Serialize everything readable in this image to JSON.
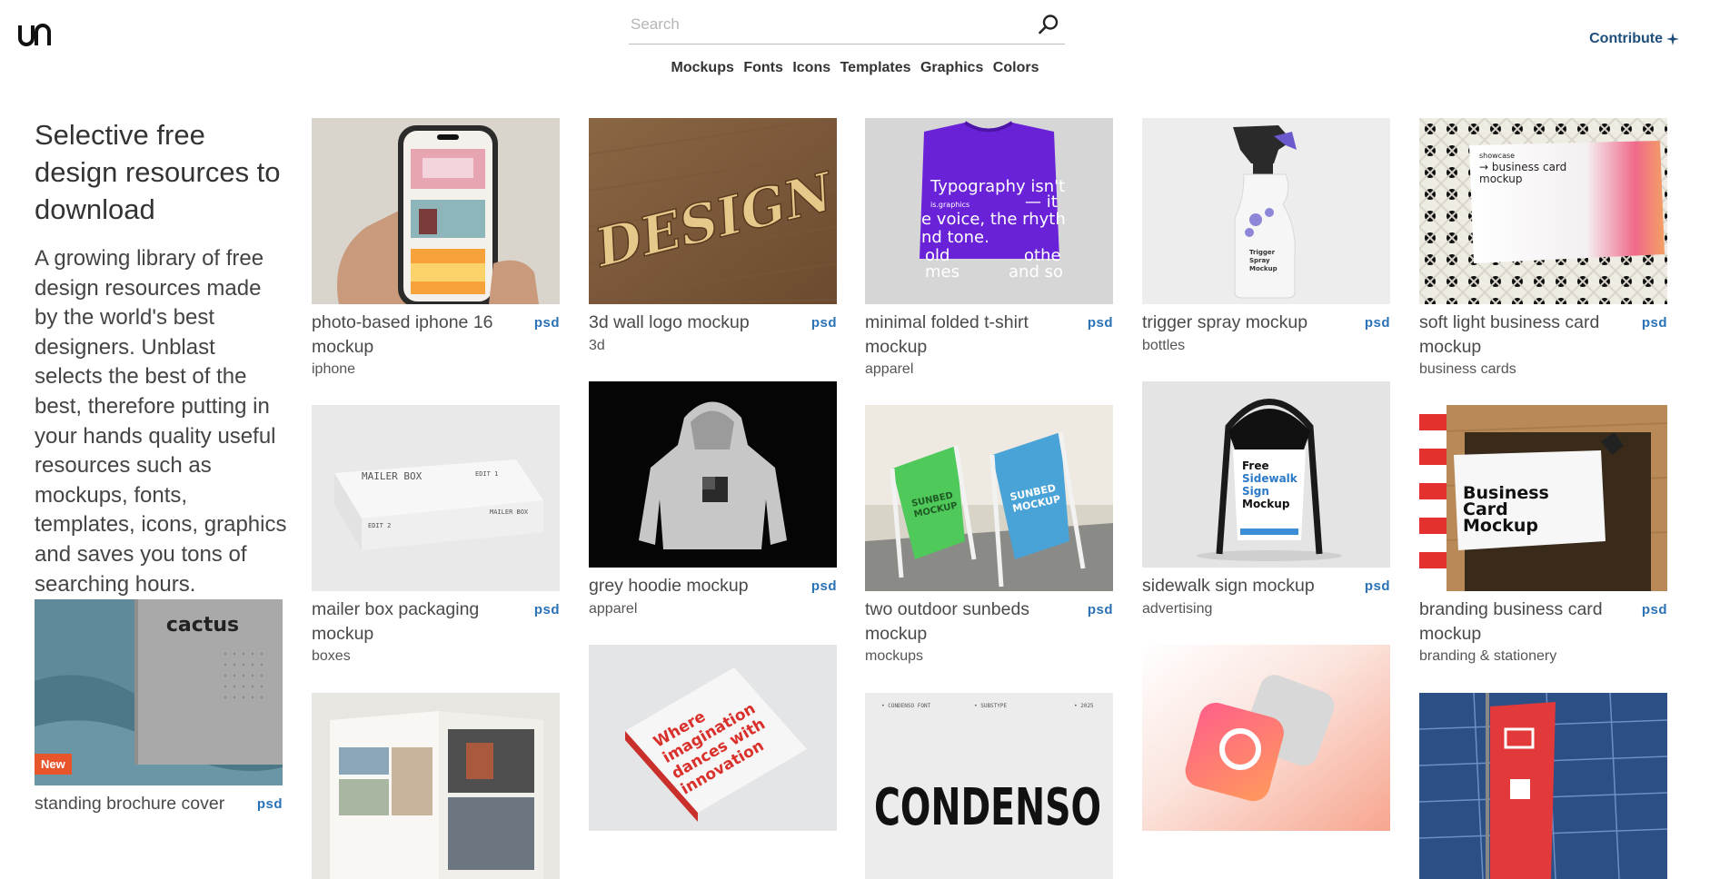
{
  "header": {
    "logo_text": "un",
    "search_placeholder": "Search",
    "contribute_label": "Contribute",
    "contribute_icon": "sparkle-icon"
  },
  "nav": [
    "Mockups",
    "Fonts",
    "Icons",
    "Templates",
    "Graphics",
    "Colors"
  ],
  "intro": {
    "heading": "Selective free design resources to download",
    "body": "A growing library of free design resources made by the world's best designers. Unblast selects the best of the best, therefore putting in your hands quality useful resources such as mockups, fonts, templates, icons, graphics and saves you tons of searching hours."
  },
  "cards": [
    {
      "title": "photo-based iphone 16 mockup",
      "format": "psd",
      "category": "iphone"
    },
    {
      "title": "3d wall logo mockup",
      "format": "psd",
      "category": "3d",
      "image_text": "DESIGN"
    },
    {
      "title": "minimal folded t-shirt mockup",
      "format": "psd",
      "category": "apparel",
      "image_text": [
        "Typography isn't",
        "is.graphics",
        "— it",
        "e voice, the rhyth",
        "nd tone.",
        "old",
        "othe",
        "mes",
        "and so"
      ]
    },
    {
      "title": "trigger spray mockup",
      "format": "psd",
      "category": "bottles",
      "image_text": [
        "Trigger",
        "Spray",
        "Mockup"
      ]
    },
    {
      "title": "soft light business card mockup",
      "format": "psd",
      "category": "business cards",
      "image_text": [
        "showcase",
        "→ business card",
        "mockup"
      ]
    },
    {
      "title": "mailer box packaging mockup",
      "format": "psd",
      "category": "boxes",
      "image_text": [
        "MAILER BOX",
        "EDIT 1",
        "EDIT 2",
        "MAILER BOX"
      ]
    },
    {
      "title": "grey hoodie mockup",
      "format": "psd",
      "category": "apparel"
    },
    {
      "title": "two outdoor sunbeds mockup",
      "format": "psd",
      "category": "mockups",
      "image_text": [
        "SUNBED",
        "MOCKUP"
      ]
    },
    {
      "title": "sidewalk sign mockup",
      "format": "psd",
      "category": "advertising",
      "image_text": [
        "Free",
        "Sidewalk",
        "Sign",
        "Mockup"
      ]
    },
    {
      "title": "branding business card mockup",
      "format": "psd",
      "category": "branding & stationery",
      "image_text": [
        "Business",
        "Card",
        "Mockup"
      ]
    },
    {
      "title": "standing brochure cover",
      "format": "psd",
      "badge": "New",
      "image_text": "cactus"
    },
    {
      "image_text": [
        "Where",
        "imagination",
        "dances with",
        "innovation"
      ]
    },
    {
      "image_text": "CONDENSO"
    }
  ]
}
